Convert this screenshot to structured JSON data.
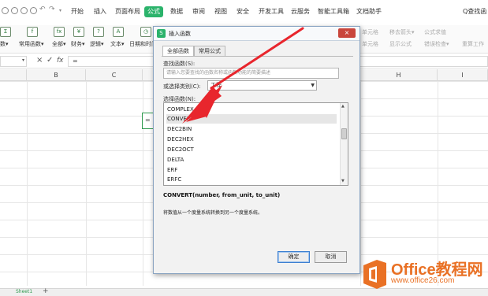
{
  "menubar": {
    "tabs": [
      "开始",
      "插入",
      "页面布局",
      "公式",
      "数据",
      "审阅",
      "视图",
      "安全",
      "开发工具",
      "云服务",
      "智能工具箱",
      "文档助手"
    ],
    "active_tab": "公式",
    "search_label": "Q查找函"
  },
  "ribbon": {
    "groups": [
      "数▾",
      "常用函数▾",
      "全部▾",
      "财务▾",
      "逻辑▾",
      "文本▾",
      "日期和时间▾"
    ],
    "right_items": [
      "单元格",
      "移去箭头▾",
      "公式求值",
      "单元格",
      "显示公式",
      "错误检查▾",
      "重算工作"
    ]
  },
  "formula_bar": {
    "cancel_icon": "×",
    "confirm_icon": "✓",
    "fx_label": "fx",
    "value": "="
  },
  "columns": [
    "B",
    "C",
    "H",
    "I"
  ],
  "active_cell_value": "=",
  "statusbar": {
    "sheet_tab": "Sheet1",
    "add_sheet": "+"
  },
  "dialog": {
    "title": "插入函数",
    "logo": "S",
    "close": "×",
    "tabs": [
      "全部函数",
      "常用公式"
    ],
    "search_label": "查找函数(S):",
    "search_placeholder": "请输入您要查找的函数名称或函数功能的简要描述",
    "category_label": "或选择类别(C):",
    "category_value": "工程",
    "select_label": "选择函数(N):",
    "functions": [
      "COMPLEX",
      "CONVERT",
      "DEC2BIN",
      "DEC2HEX",
      "DEC2OCT",
      "DELTA",
      "ERF",
      "ERFC"
    ],
    "selected_function": "CONVERT",
    "signature": "CONVERT(number, from_unit, to_unit)",
    "description": "将数值从一个度量系统转换到另一个度量系统。",
    "ok_label": "确定",
    "cancel_label": "取消"
  },
  "watermark": {
    "title": "Office教程网",
    "url": "www.office26.com"
  },
  "colors": {
    "accent": "#2bb36b",
    "arrow": "#e8262d",
    "watermark": "#e97125"
  }
}
